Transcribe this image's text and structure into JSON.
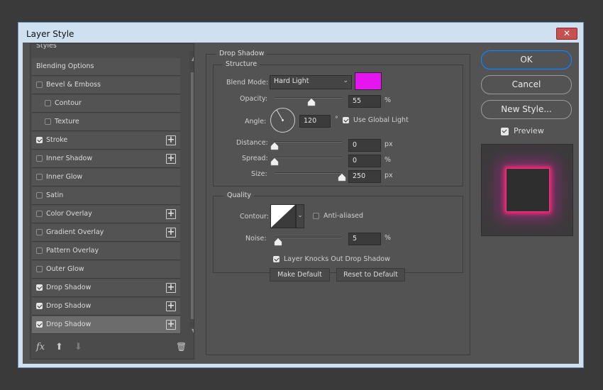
{
  "window": {
    "title": "Layer Style",
    "close_glyph": "✕"
  },
  "styles_list": {
    "header": "Styles",
    "items": [
      {
        "label": "Blending Options",
        "checkbox": false,
        "checked": false,
        "plus": false,
        "indent": false,
        "selected": false
      },
      {
        "label": "Bevel & Emboss",
        "checkbox": true,
        "checked": false,
        "plus": false,
        "indent": false,
        "selected": false
      },
      {
        "label": "Contour",
        "checkbox": true,
        "checked": false,
        "plus": false,
        "indent": true,
        "selected": false
      },
      {
        "label": "Texture",
        "checkbox": true,
        "checked": false,
        "plus": false,
        "indent": true,
        "selected": false
      },
      {
        "label": "Stroke",
        "checkbox": true,
        "checked": true,
        "plus": true,
        "indent": false,
        "selected": false
      },
      {
        "label": "Inner Shadow",
        "checkbox": true,
        "checked": false,
        "plus": true,
        "indent": false,
        "selected": false
      },
      {
        "label": "Inner Glow",
        "checkbox": true,
        "checked": false,
        "plus": false,
        "indent": false,
        "selected": false
      },
      {
        "label": "Satin",
        "checkbox": true,
        "checked": false,
        "plus": false,
        "indent": false,
        "selected": false
      },
      {
        "label": "Color Overlay",
        "checkbox": true,
        "checked": false,
        "plus": true,
        "indent": false,
        "selected": false
      },
      {
        "label": "Gradient Overlay",
        "checkbox": true,
        "checked": false,
        "plus": true,
        "indent": false,
        "selected": false
      },
      {
        "label": "Pattern Overlay",
        "checkbox": true,
        "checked": false,
        "plus": false,
        "indent": false,
        "selected": false
      },
      {
        "label": "Outer Glow",
        "checkbox": true,
        "checked": false,
        "plus": false,
        "indent": false,
        "selected": false
      },
      {
        "label": "Drop Shadow",
        "checkbox": true,
        "checked": true,
        "plus": true,
        "indent": false,
        "selected": false
      },
      {
        "label": "Drop Shadow",
        "checkbox": true,
        "checked": true,
        "plus": true,
        "indent": false,
        "selected": false
      },
      {
        "label": "Drop Shadow",
        "checkbox": true,
        "checked": true,
        "plus": true,
        "indent": false,
        "selected": true
      }
    ],
    "toolbar": {
      "fx": "fx",
      "up": "⬆",
      "down": "⬇",
      "trash": "🗑"
    }
  },
  "drop_shadow": {
    "title": "Drop Shadow",
    "structure": {
      "title": "Structure",
      "blend_mode_label": "Blend Mode:",
      "blend_mode_value": "Hard Light",
      "color": "#e614ee",
      "opacity_label": "Opacity:",
      "opacity_value": "55",
      "opacity_unit": "%",
      "opacity_level": 0.55,
      "angle_label": "Angle:",
      "angle_value": "120",
      "angle_unit": "°",
      "use_global_light_label": "Use Global Light",
      "use_global_light": true,
      "distance_label": "Distance:",
      "distance_value": "0",
      "distance_unit": "px",
      "distance_level": 0,
      "spread_label": "Spread:",
      "spread_value": "0",
      "spread_unit": "%",
      "spread_level": 0,
      "size_label": "Size:",
      "size_value": "250",
      "size_unit": "px",
      "size_level": 1.0
    },
    "quality": {
      "title": "Quality",
      "contour_label": "Contour:",
      "anti_aliased_label": "Anti-aliased",
      "anti_aliased": false,
      "noise_label": "Noise:",
      "noise_value": "5",
      "noise_unit": "%",
      "noise_level": 0.05
    },
    "knocks_out_label": "Layer Knocks Out Drop Shadow",
    "knocks_out": true,
    "make_default": "Make Default",
    "reset_default": "Reset to Default"
  },
  "buttons": {
    "ok": "OK",
    "cancel": "Cancel",
    "new_style": "New Style..."
  },
  "preview": {
    "label": "Preview",
    "checked": true,
    "glow_color": "#ff2a7a"
  }
}
